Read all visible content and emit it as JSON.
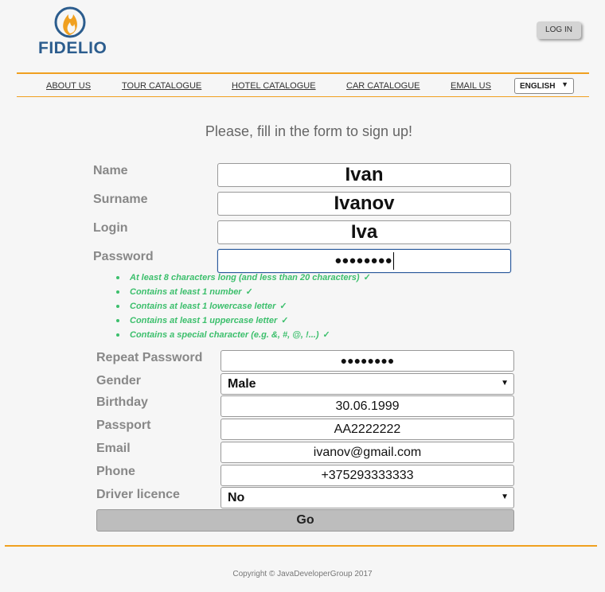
{
  "brand": {
    "name": "FIDELIO",
    "accent_color": "#f0a020",
    "logo_color": "#2c5d8e"
  },
  "header": {
    "login_label": "LOG IN"
  },
  "nav": {
    "items": [
      "ABOUT US",
      "TOUR CATALOGUE",
      "HOTEL CATALOGUE",
      "CAR CATALOGUE",
      "EMAIL US"
    ],
    "language": "ENGLISH"
  },
  "form": {
    "heading": "Please, fill in the form to sign up!",
    "name": {
      "label": "Name",
      "value": "Ivan"
    },
    "surname": {
      "label": "Surname",
      "value": "Ivanov"
    },
    "login": {
      "label": "Login",
      "value": "Iva"
    },
    "password": {
      "label": "Password",
      "value": "●●●●●●●●"
    },
    "password_rules": [
      "At least 8 characters long (and less than 20 characters)",
      "Contains at least 1 number",
      "Contains at least 1 lowercase letter",
      "Contains at least 1 uppercase letter",
      "Contains a special character (e.g. &, #, @, !...)"
    ],
    "rule_check": "✓",
    "repeat_password": {
      "label": "Repeat Password",
      "value": "●●●●●●●●"
    },
    "gender": {
      "label": "Gender",
      "value": "Male"
    },
    "birthday": {
      "label": "Birthday",
      "value": "30.06.1999"
    },
    "passport": {
      "label": "Passport",
      "value": "AA2222222"
    },
    "email": {
      "label": "Email",
      "value": "ivanov@gmail.com"
    },
    "phone": {
      "label": "Phone",
      "value": "+375293333333"
    },
    "driver_licence": {
      "label": "Driver licence",
      "value": "No"
    },
    "submit_label": "Go"
  },
  "footer": {
    "copyright": "Copyright © JavaDeveloperGroup 2017"
  }
}
